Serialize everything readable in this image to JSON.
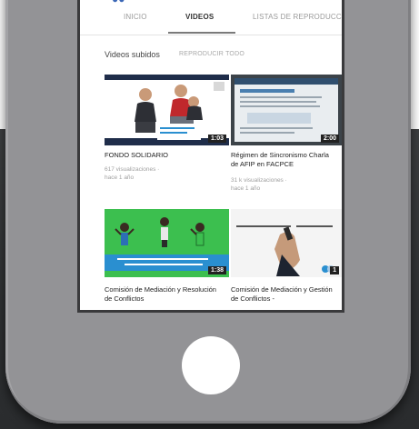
{
  "tabs": [
    {
      "label": "INICIO"
    },
    {
      "label": "VIDEOS"
    },
    {
      "label": "LISTAS DE REPRODUCC"
    }
  ],
  "section": {
    "title": "Videos subidos",
    "play_all": "REPRODUCIR TODO"
  },
  "videos": [
    {
      "title": "FONDO SOLIDARIO",
      "meta_line1": "617 visualizaciones ·",
      "meta_line2": "hace 1 año",
      "duration": "1:03"
    },
    {
      "title": "Régimen de Sincronismo Charla de AFIP en FACPCE",
      "meta_line1": "31 k visualizaciones ·",
      "meta_line2": "hace 1 año",
      "duration": "2:00"
    },
    {
      "title": "Comisión de Mediación y Resolución de Conflictos",
      "duration": "1:38"
    },
    {
      "title": "Comisión de Mediación y Gestión de Conflictos -",
      "duration": "1"
    }
  ],
  "colors": {
    "phone_body": "#939396",
    "thumb_green": "#3cbf4f",
    "thumb_blue_banner": "#2a8fd0"
  }
}
